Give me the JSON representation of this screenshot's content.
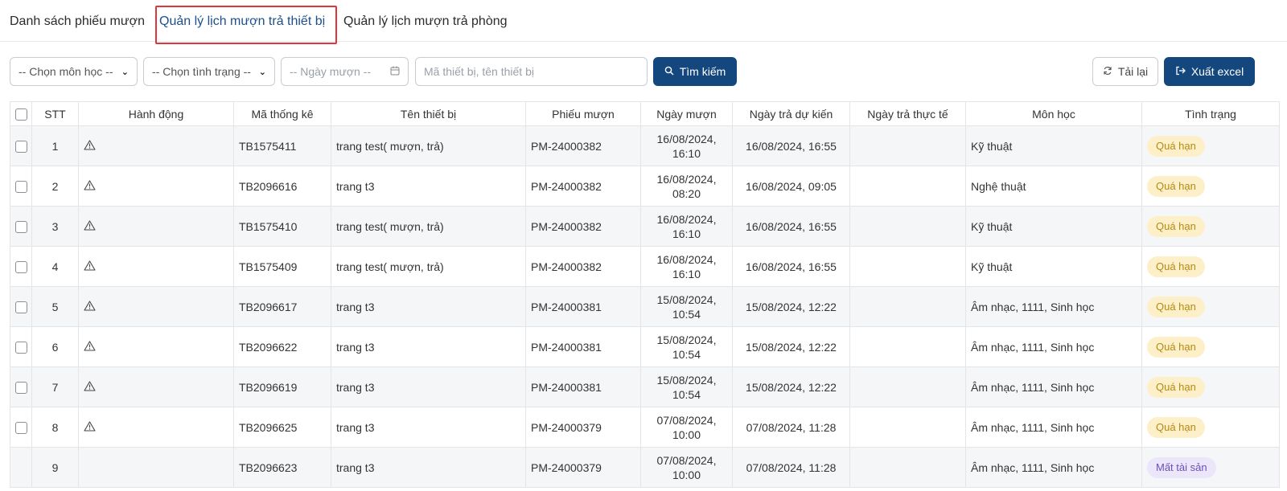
{
  "tabs": [
    {
      "label": "Danh sách phiếu mượn"
    },
    {
      "label": "Quản lý lịch mượn trả thiết bị"
    },
    {
      "label": "Quản lý lịch mượn trả phòng"
    }
  ],
  "filters": {
    "subject": "-- Chọn môn học --",
    "status": "-- Chọn tình trạng --",
    "borrow_date_placeholder": "-- Ngày mượn --",
    "search_placeholder": "Mã thiết bị, tên thiết bị"
  },
  "buttons": {
    "search": "Tìm kiếm",
    "reload": "Tải lại",
    "export": "Xuất excel"
  },
  "table": {
    "headers": [
      "STT",
      "Hành động",
      "Mã thống kê",
      "Tên thiết bị",
      "Phiếu mượn",
      "Ngày mượn",
      "Ngày trả dự kiến",
      "Ngày trả thực tế",
      "Môn học",
      "Tình trạng"
    ],
    "rows": [
      {
        "stt": "1",
        "code": "TB1575411",
        "name": "trang test( mượn, trả)",
        "slip": "PM-24000382",
        "borrow_date": "16/08/2024,",
        "borrow_time": "16:10",
        "due": "16/08/2024, 16:55",
        "returned": "",
        "subject": "Kỹ thuật",
        "status": "Quá hạn"
      },
      {
        "stt": "2",
        "code": "TB2096616",
        "name": "trang t3",
        "slip": "PM-24000382",
        "borrow_date": "16/08/2024,",
        "borrow_time": "08:20",
        "due": "16/08/2024, 09:05",
        "returned": "",
        "subject": "Nghệ thuật",
        "status": "Quá hạn"
      },
      {
        "stt": "3",
        "code": "TB1575410",
        "name": "trang test( mượn, trả)",
        "slip": "PM-24000382",
        "borrow_date": "16/08/2024,",
        "borrow_time": "16:10",
        "due": "16/08/2024, 16:55",
        "returned": "",
        "subject": "Kỹ thuật",
        "status": "Quá hạn"
      },
      {
        "stt": "4",
        "code": "TB1575409",
        "name": "trang test( mượn, trả)",
        "slip": "PM-24000382",
        "borrow_date": "16/08/2024,",
        "borrow_time": "16:10",
        "due": "16/08/2024, 16:55",
        "returned": "",
        "subject": "Kỹ thuật",
        "status": "Quá hạn"
      },
      {
        "stt": "5",
        "code": "TB2096617",
        "name": "trang t3",
        "slip": "PM-24000381",
        "borrow_date": "15/08/2024,",
        "borrow_time": "10:54",
        "due": "15/08/2024, 12:22",
        "returned": "",
        "subject": "Âm nhạc, 1111, Sinh học",
        "status": "Quá hạn"
      },
      {
        "stt": "6",
        "code": "TB2096622",
        "name": "trang t3",
        "slip": "PM-24000381",
        "borrow_date": "15/08/2024,",
        "borrow_time": "10:54",
        "due": "15/08/2024, 12:22",
        "returned": "",
        "subject": "Âm nhạc, 1111, Sinh học",
        "status": "Quá hạn"
      },
      {
        "stt": "7",
        "code": "TB2096619",
        "name": "trang t3",
        "slip": "PM-24000381",
        "borrow_date": "15/08/2024,",
        "borrow_time": "10:54",
        "due": "15/08/2024, 12:22",
        "returned": "",
        "subject": "Âm nhạc, 1111, Sinh học",
        "status": "Quá hạn"
      },
      {
        "stt": "8",
        "code": "TB2096625",
        "name": "trang t3",
        "slip": "PM-24000379",
        "borrow_date": "07/08/2024,",
        "borrow_time": "10:00",
        "due": "07/08/2024, 11:28",
        "returned": "",
        "subject": "Âm nhạc, 1111, Sinh học",
        "status": "Quá hạn"
      },
      {
        "stt": "9",
        "code": "TB2096623",
        "name": "trang t3",
        "slip": "PM-24000379",
        "borrow_date": "07/08/2024,",
        "borrow_time": "10:00",
        "due": "07/08/2024, 11:28",
        "returned": "",
        "subject": "Âm nhạc, 1111, Sinh học",
        "status": "Mất tài sản"
      }
    ]
  },
  "colors": {
    "primary": "#15477f",
    "active_tab": "#1d4f8c",
    "highlight_border": "#e0353d",
    "overdue_bg": "#fdf0c8",
    "overdue_text": "#b48a12",
    "lost_bg": "#ece6fa",
    "lost_text": "#6b50b5"
  },
  "icons": {
    "row_action": "warning-triangle-icon",
    "search": "search-icon",
    "reload": "refresh-icon",
    "export": "export-icon",
    "calendar": "calendar-icon"
  }
}
